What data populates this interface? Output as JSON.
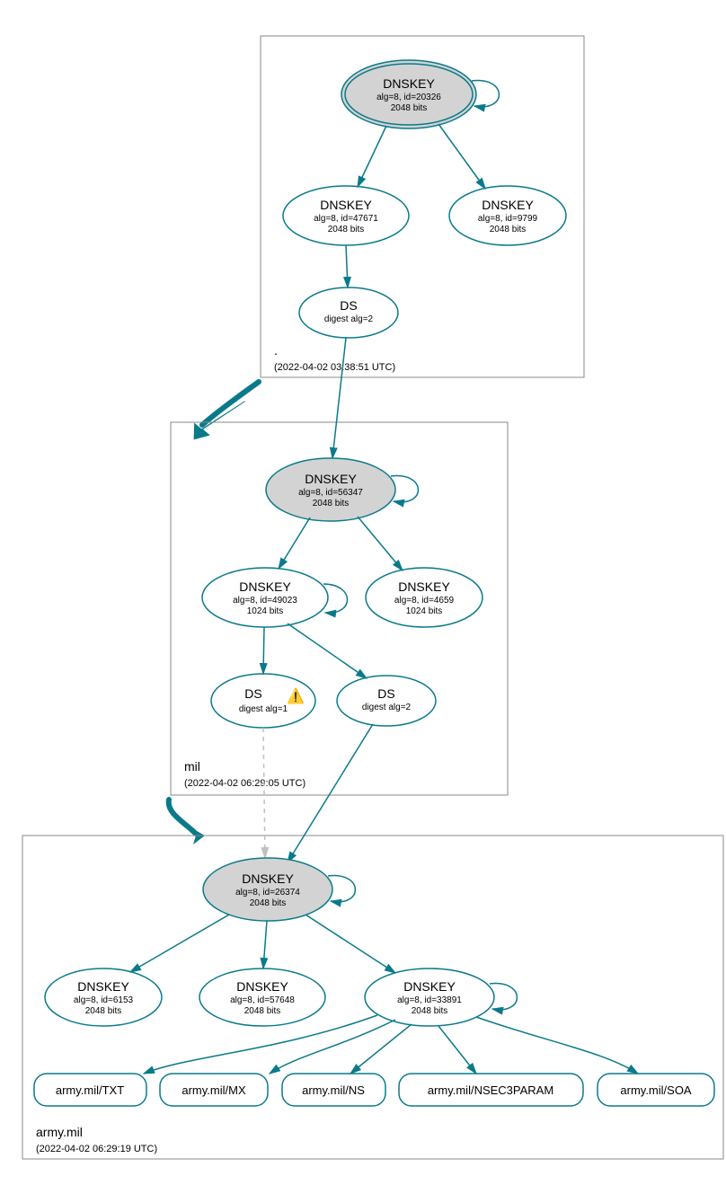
{
  "zones": {
    "root": {
      "label": ".",
      "timestamp": "(2022-04-02 03:38:51 UTC)",
      "ksk": {
        "title": "DNSKEY",
        "sub1": "alg=8, id=20326",
        "sub2": "2048 bits"
      },
      "zsk1": {
        "title": "DNSKEY",
        "sub1": "alg=8, id=47671",
        "sub2": "2048 bits"
      },
      "zsk2": {
        "title": "DNSKEY",
        "sub1": "alg=8, id=9799",
        "sub2": "2048 bits"
      },
      "ds": {
        "title": "DS",
        "sub1": "digest alg=2"
      }
    },
    "mil": {
      "label": "mil",
      "timestamp": "(2022-04-02 06:29:05 UTC)",
      "ksk": {
        "title": "DNSKEY",
        "sub1": "alg=8, id=56347",
        "sub2": "2048 bits"
      },
      "zsk1": {
        "title": "DNSKEY",
        "sub1": "alg=8, id=49023",
        "sub2": "1024 bits"
      },
      "zsk2": {
        "title": "DNSKEY",
        "sub1": "alg=8, id=4659",
        "sub2": "1024 bits"
      },
      "ds1": {
        "title": "DS",
        "sub1": "digest alg=1"
      },
      "ds2": {
        "title": "DS",
        "sub1": "digest alg=2"
      }
    },
    "army": {
      "label": "army.mil",
      "timestamp": "(2022-04-02 06:29:19 UTC)",
      "ksk": {
        "title": "DNSKEY",
        "sub1": "alg=8, id=26374",
        "sub2": "2048 bits"
      },
      "zsk1": {
        "title": "DNSKEY",
        "sub1": "alg=8, id=6153",
        "sub2": "2048 bits"
      },
      "zsk2": {
        "title": "DNSKEY",
        "sub1": "alg=8, id=57648",
        "sub2": "2048 bits"
      },
      "zsk3": {
        "title": "DNSKEY",
        "sub1": "alg=8, id=33891",
        "sub2": "2048 bits"
      },
      "rr": {
        "txt": "army.mil/TXT",
        "mx": "army.mil/MX",
        "ns": "army.mil/NS",
        "nsec3": "army.mil/NSEC3PARAM",
        "soa": "army.mil/SOA"
      }
    }
  }
}
